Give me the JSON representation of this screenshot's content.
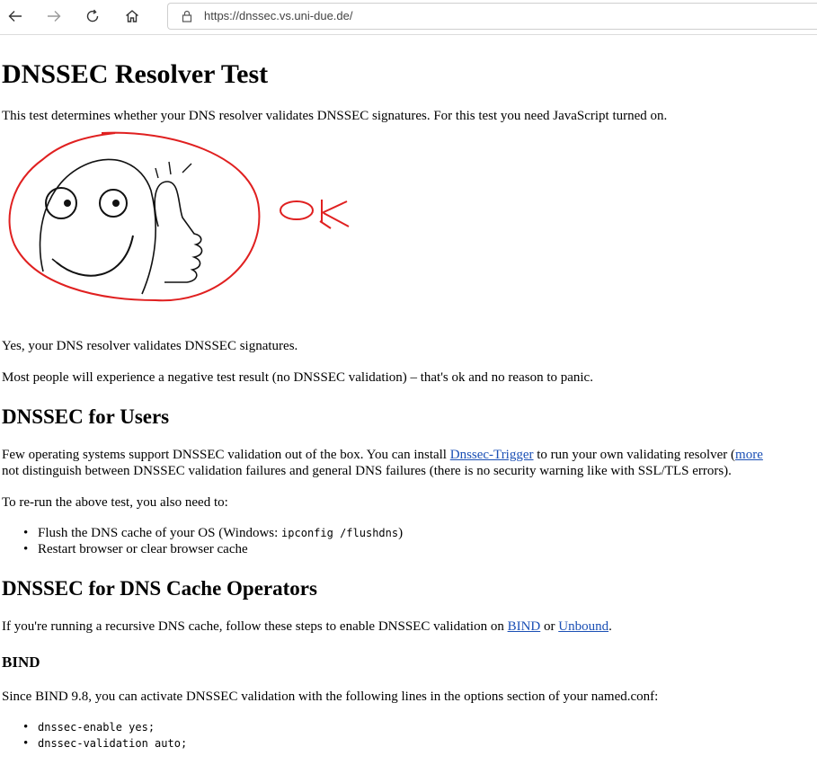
{
  "browser": {
    "url": "https://dnssec.vs.uni-due.de/"
  },
  "page": {
    "title": "DNSSEC Resolver Test",
    "intro": "This test determines whether your DNS resolver validates DNSSEC signatures. For this test you need JavaScript turned on.",
    "drawing_caption": "OK",
    "result": "Yes, your DNS resolver validates DNSSEC signatures.",
    "note": "Most people will experience a negative test result (no DNSSEC validation) – that's ok and no reason to panic.",
    "users": {
      "heading": "DNSSEC for Users",
      "p1_a": "Few operating systems support DNSSEC validation out of the box. You can install ",
      "p1_link": "Dnssec-Trigger",
      "p1_b": " to run your own validating resolver (",
      "p1_link2": "more",
      "p2": "not distinguish between DNSSEC validation failures and general DNS failures (there is no security warning like with SSL/TLS errors).",
      "rerun": "To re-run the above test, you also need to:",
      "step1_text": "Flush the DNS cache of your OS (Windows: ",
      "step1_code": "ipconfig /flushdns",
      "step1_end": ")",
      "step2": "Restart browser or clear browser cache"
    },
    "operators": {
      "heading": "DNSSEC for DNS Cache Operators",
      "p_a": "If you're running a recursive DNS cache, follow these steps to enable DNSSEC validation on ",
      "link_bind": "BIND",
      "p_or": " or ",
      "link_unbound": "Unbound",
      "p_end": ".",
      "bind_heading": "BIND",
      "bind_p": "Since BIND 9.8, you can activate DNSSEC validation with the following lines in the options section of your named.conf:",
      "code1": "dnssec-enable yes;",
      "code2": "dnssec-validation auto;"
    }
  }
}
